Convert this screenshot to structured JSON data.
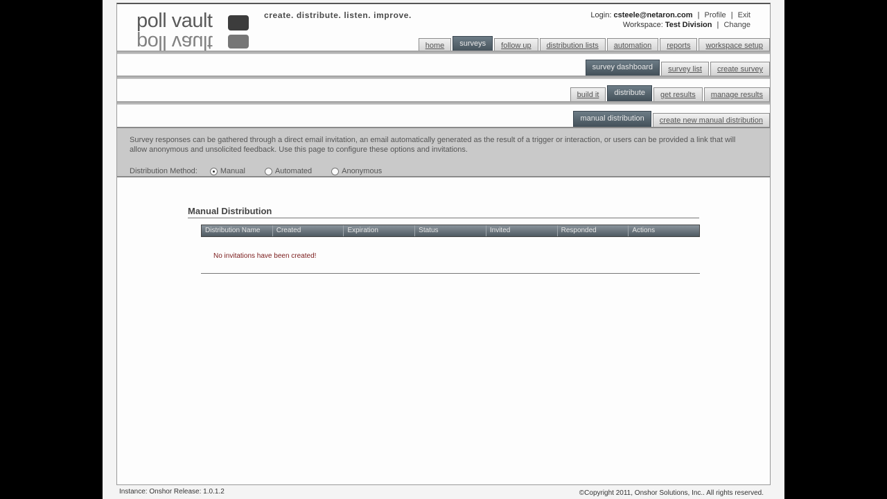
{
  "brand": {
    "name": "poll vault",
    "tagline": "create.  distribute.  listen.  improve."
  },
  "user": {
    "login_label": "Login:",
    "login_email": "csteele@netaron.com",
    "profile": "Profile",
    "exit": "Exit",
    "workspace_label": "Workspace:",
    "workspace_name": "Test Division",
    "change": "Change"
  },
  "nav": {
    "main_tabs": [
      "home",
      "surveys",
      "follow up",
      "distribution lists",
      "automation",
      "reports",
      "workspace setup"
    ],
    "main_active": 1,
    "survey_tabs": [
      "survey dashboard",
      "survey list",
      "create survey"
    ],
    "survey_active": 0,
    "build_tabs": [
      "build it",
      "distribute",
      "get results",
      "manage results"
    ],
    "build_active": 1,
    "dist_tabs": [
      "manual distribution",
      "create new manual distribution"
    ],
    "dist_active": 0
  },
  "info": {
    "text": "Survey responses can be gathered through a direct email invitation, an email automatically generated as the result of a trigger or interaction, or users can be provided a link that will allow anonymous and unsolicited feedback. Use this page to configure these options and invitations.",
    "method_label": "Distribution Method:",
    "methods": [
      "Manual",
      "Automated",
      "Anonymous"
    ],
    "selected_method": "Manual"
  },
  "section": {
    "title": "Manual Distribution",
    "columns": [
      "Distribution Name",
      "Created",
      "Expiration",
      "Status",
      "Invited",
      "Responded",
      "Actions"
    ],
    "empty_message": "No invitations have been created!"
  },
  "footer": {
    "instance": "Instance: Onshor   Release: 1.0.1.2",
    "copyright": "©Copyright 2011, Onshor Solutions, Inc.. All rights reserved."
  }
}
